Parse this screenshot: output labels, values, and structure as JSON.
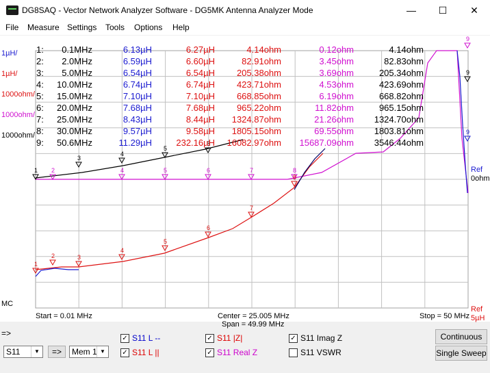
{
  "window": {
    "title": "DG8SAQ  -  Vector Network Analyzer Software - DG5MK Antenna Analyzer Mode",
    "minimize_glyph": "—",
    "maximize_glyph": "☐",
    "close_glyph": "✕"
  },
  "menu": [
    "File",
    "Measure",
    "Settings",
    "Tools",
    "Options",
    "Help"
  ],
  "scale_labels": {
    "s1": "1µH/",
    "s2": "1µH/",
    "s3": "1000ohm/",
    "s4": "1000ohm/",
    "s5": "1000ohm/",
    "mc": "MC",
    "arrow": "=>"
  },
  "markers_table": [
    {
      "idx": "1:",
      "freq": "0.1MHz",
      "L": "6.13µH",
      "Lpar": "6.27µH",
      "absZ": "4.14ohm",
      "realZ": "0.12ohm",
      "imagZ": "4.14ohm"
    },
    {
      "idx": "2:",
      "freq": "2.0MHz",
      "L": "6.59µH",
      "Lpar": "6.60µH",
      "absZ": "82.91ohm",
      "realZ": "3.45ohm",
      "imagZ": "82.83ohm"
    },
    {
      "idx": "3:",
      "freq": "5.0MHz",
      "L": "6.54µH",
      "Lpar": "6.54µH",
      "absZ": "205.38ohm",
      "realZ": "3.69ohm",
      "imagZ": "205.34ohm"
    },
    {
      "idx": "4:",
      "freq": "10.0MHz",
      "L": "6.74µH",
      "Lpar": "6.74µH",
      "absZ": "423.71ohm",
      "realZ": "4.53ohm",
      "imagZ": "423.69ohm"
    },
    {
      "idx": "5:",
      "freq": "15.0MHz",
      "L": "7.10µH",
      "Lpar": "7.10µH",
      "absZ": "668.85ohm",
      "realZ": "6.19ohm",
      "imagZ": "668.82ohm"
    },
    {
      "idx": "6:",
      "freq": "20.0MHz",
      "L": "7.68µH",
      "Lpar": "7.68µH",
      "absZ": "965.22ohm",
      "realZ": "11.82ohm",
      "imagZ": "965.15ohm"
    },
    {
      "idx": "7:",
      "freq": "25.0MHz",
      "L": "8.43µH",
      "Lpar": "8.44µH",
      "absZ": "1324.87ohm",
      "realZ": "21.26ohm",
      "imagZ": "1324.70ohm"
    },
    {
      "idx": "8:",
      "freq": "30.0MHz",
      "L": "9.57µH",
      "Lpar": "9.58µH",
      "absZ": "1805.15ohm",
      "realZ": "69.55ohm",
      "imagZ": "1803.81ohm"
    },
    {
      "idx": "9:",
      "freq": "50.6MHz",
      "L": "11.29µH",
      "Lpar": "232.16µH",
      "absZ": "16082.97ohm",
      "realZ": "15687.09ohm",
      "imagZ": "3546.44ohm"
    }
  ],
  "footer": {
    "start": "Start = 0.01 MHz",
    "center": "Center = 25.005 MHz",
    "span": "Span = 49.99 MHz",
    "stop": "Stop = 50 MHz",
    "ref_top": "Ref",
    "ref_top_value": "0ohm",
    "ref_bottom": "Ref",
    "ref_bottom_value": "5µH"
  },
  "marker_digits": [
    "1",
    "2",
    "3",
    "4",
    "5",
    "6",
    "7",
    "8",
    "9"
  ],
  "controls": {
    "port_select": "S11",
    "apply_button": "=>",
    "mem_select": "Mem 1",
    "continuous": "Continuous",
    "single_sweep": "Single Sweep",
    "checkmark": "✓",
    "dropdown_glyph": "▼",
    "checks": [
      {
        "label": "S11  L --",
        "checked": true,
        "color": "#0000cc"
      },
      {
        "label": "S11  L ||",
        "checked": true,
        "color": "#dd0000"
      },
      {
        "label": "S11  |Z|",
        "checked": true,
        "color": "#dd0000"
      },
      {
        "label": "S11  Real Z",
        "checked": true,
        "color": "#cc00cc"
      },
      {
        "label": "S11  Imag Z",
        "checked": true,
        "color": "#000000"
      },
      {
        "label": "S11  VSWR",
        "checked": false,
        "color": "#000000"
      }
    ]
  },
  "colors": {
    "L": "#1a1ad0",
    "Lpar": "#dd1111",
    "absZ": "#dd1111",
    "realZ": "#d010d0",
    "imagZ": "#000000",
    "grid": "#c0c0c0"
  }
}
